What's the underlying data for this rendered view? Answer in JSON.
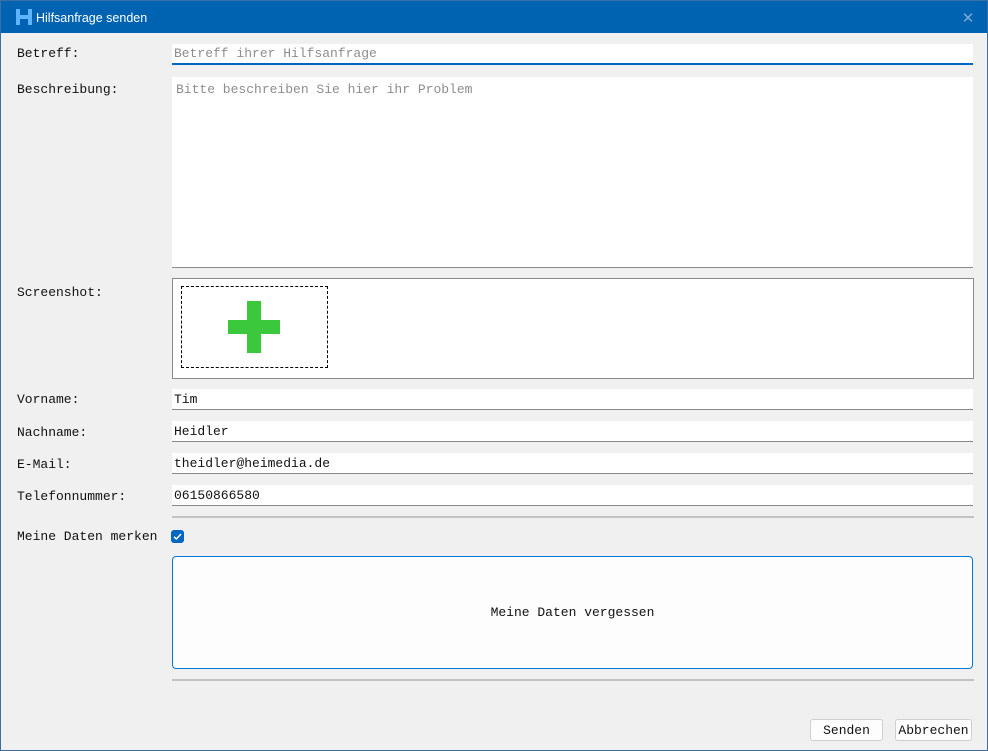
{
  "window": {
    "title": "Hilfsanfrage senden",
    "app_icon": "h-logo-icon",
    "close_icon": "close-icon",
    "close_glyph": "✕",
    "titlebar_color": "#0063b1"
  },
  "form": {
    "subject": {
      "label": "Betreff:",
      "value": "",
      "placeholder": "Betreff ihrer Hilfsanfrage"
    },
    "description": {
      "label": "Beschreibung:",
      "value": "",
      "placeholder": "Bitte beschreiben Sie hier ihr Problem"
    },
    "screenshot": {
      "label": "Screenshot:",
      "add_icon": "plus-icon",
      "add_icon_color": "#3cc83c"
    },
    "first_name": {
      "label": "Vorname:",
      "value": "Tim"
    },
    "last_name": {
      "label": "Nachname:",
      "value": "Heidler"
    },
    "email": {
      "label": "E-Mail:",
      "value": "theidler@heimedia.de"
    },
    "phone": {
      "label": "Telefonnummer:",
      "value": "06150866580"
    },
    "remember": {
      "label": "Meine Daten merken",
      "checked": true
    },
    "forget_button": {
      "label": "Meine Daten vergessen"
    }
  },
  "footer": {
    "send_label": "Senden",
    "cancel_label": "Abbrechen"
  },
  "colors": {
    "accent": "#0067c0",
    "plus": "#3cc83c"
  }
}
